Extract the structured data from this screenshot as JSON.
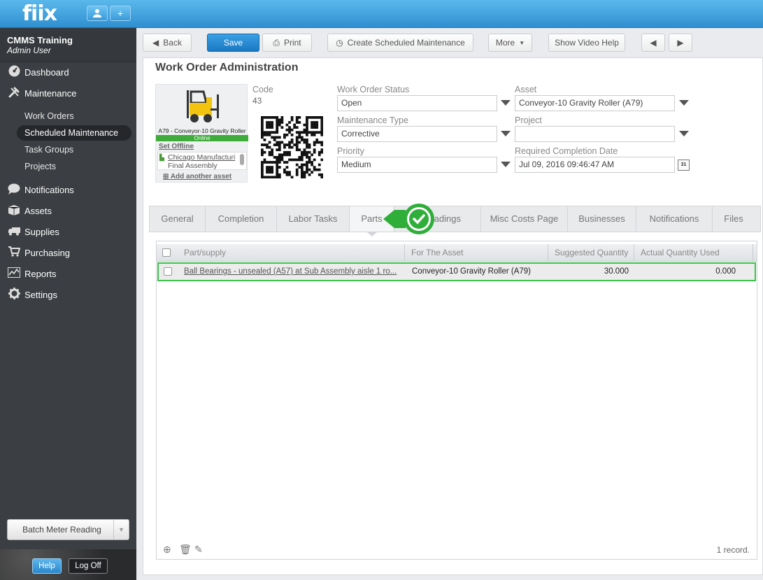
{
  "topbar": {
    "logo": "fiix",
    "user_icon": "user-icon",
    "add_icon": "plus-icon",
    "add_label": "+"
  },
  "account": {
    "org": "CMMS Training",
    "role": "Admin User"
  },
  "nav": {
    "dashboard": "Dashboard",
    "maintenance": "Maintenance",
    "sub": {
      "work_orders": "Work Orders",
      "scheduled_maintenance": "Scheduled Maintenance",
      "task_groups": "Task Groups",
      "projects": "Projects"
    },
    "notifications": "Notifications",
    "assets": "Assets",
    "supplies": "Supplies",
    "purchasing": "Purchasing",
    "reports": "Reports",
    "settings": "Settings"
  },
  "sidebar_footer": {
    "batch_meter": "Batch Meter Reading",
    "help": "Help",
    "log_off": "Log Off"
  },
  "toolbar": {
    "back": "Back",
    "save": "Save",
    "print": "Print",
    "create_scheduled": "Create Scheduled Maintenance",
    "more": "More",
    "show_video_help": "Show Video Help"
  },
  "page": {
    "title": "Work Order Administration"
  },
  "asset_card": {
    "name": "A79 - Conveyor-10 Gravity Roller",
    "status": "Online",
    "set_offline": "Set Offline",
    "location1": "Chicago Manufacturi",
    "location2": "Final Assembly",
    "add_asset": "Add another asset"
  },
  "fields": {
    "code_label": "Code",
    "code_value": "43",
    "status_label": "Work Order Status",
    "status_value": "Open",
    "asset_label": "Asset",
    "asset_value": "Conveyor-10 Gravity Roller (A79)",
    "mtype_label": "Maintenance Type",
    "mtype_value": "Corrective",
    "project_label": "Project",
    "project_value": "",
    "priority_label": "Priority",
    "priority_value": "Medium",
    "rcd_label": "Required Completion Date",
    "rcd_value": "Jul 09, 2016 09:46:47 AM",
    "calendar_text": "31"
  },
  "tabs": [
    "General",
    "Completion",
    "Labor Tasks",
    "Parts",
    "eadings",
    "Misc Costs Page",
    "Businesses",
    "Notifications",
    "Files"
  ],
  "grid": {
    "headers": [
      "Part/supply",
      "For The Asset",
      "Suggested Quantity",
      "Actual Quantity Used"
    ],
    "rows": [
      {
        "part": "Ball Bearings - unsealed (A57) at Sub Assembly aisle 1 ro...",
        "asset": "Conveyor-10 Gravity Roller (A79)",
        "suggested": "30.000",
        "actual": "0.000"
      }
    ],
    "record_count": "1 record."
  },
  "colors": {
    "topbar": "#3aa0e4",
    "sidebar": "#3b3e42",
    "highlight": "#3cc24a",
    "online": "#3eab3a"
  }
}
